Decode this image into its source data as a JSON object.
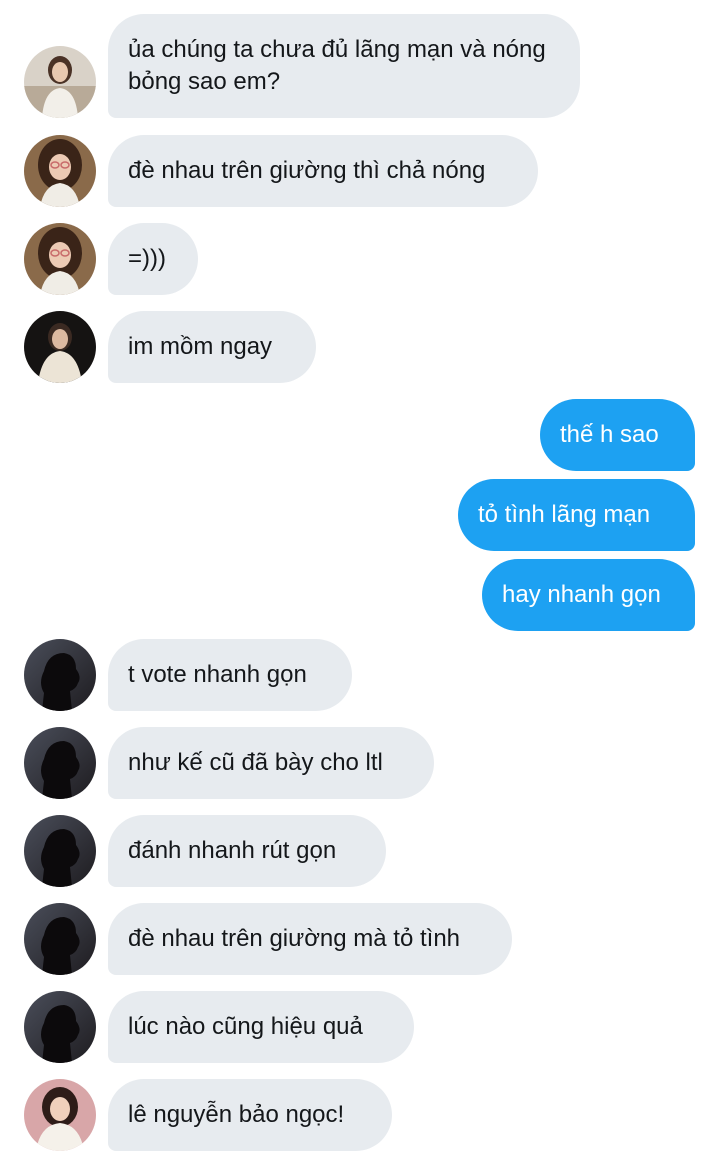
{
  "conversation": {
    "messages": [
      {
        "side": "in",
        "avatar": "avatar-girl-white-sweater",
        "text": "ủa chúng ta chưa đủ lãng mạn và nóng bỏng sao em?"
      },
      {
        "side": "in",
        "avatar": "avatar-girl-glasses",
        "text": "đè nhau trên giường thì chả nóng"
      },
      {
        "side": "in",
        "avatar": "avatar-girl-glasses",
        "text": "=)))"
      },
      {
        "side": "in",
        "avatar": "avatar-girl-dark-background",
        "text": "im mồm ngay"
      },
      {
        "side": "out",
        "text": "thế h sao"
      },
      {
        "side": "out",
        "text": "tỏ tình lãng mạn"
      },
      {
        "side": "out",
        "text": "hay nhanh gọn"
      },
      {
        "side": "in",
        "avatar": "avatar-silhouette",
        "text": "t vote nhanh gọn"
      },
      {
        "side": "in",
        "avatar": "avatar-silhouette",
        "text": "như kế cũ đã bày cho ltl"
      },
      {
        "side": "in",
        "avatar": "avatar-silhouette",
        "text": "đánh nhanh rút gọn"
      },
      {
        "side": "in",
        "avatar": "avatar-silhouette",
        "text": "đè nhau trên giường mà tỏ tình"
      },
      {
        "side": "in",
        "avatar": "avatar-silhouette",
        "text": "lúc nào cũng hiệu quả"
      },
      {
        "side": "in",
        "avatar": "avatar-girl-pink-background",
        "text": "lê nguyễn bảo ngọc!"
      }
    ]
  },
  "colors": {
    "incoming_bubble": "#e7ebef",
    "outgoing_bubble": "#1da1f2",
    "incoming_text": "#14171a",
    "outgoing_text": "#ffffff"
  }
}
